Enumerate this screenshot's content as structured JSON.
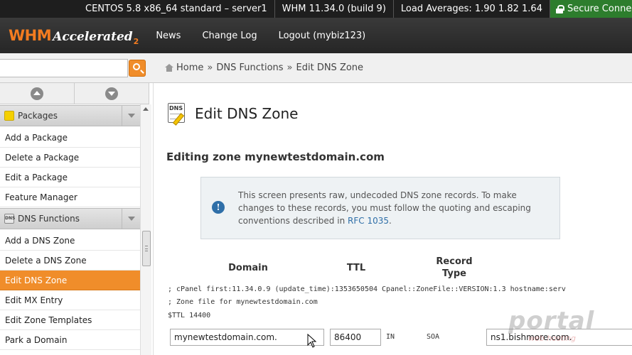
{
  "statusbar": {
    "server": "CENTOS 5.8 x86_64 standard – server1",
    "version": "WHM 11.34.0 (build 9)",
    "load": "Load Averages: 1.90 1.82 1.64",
    "secure": "Secure Connectio"
  },
  "header": {
    "logo_whm": "WHM",
    "logo_accelerated": "Accelerated",
    "logo_version": "2",
    "nav": [
      "News",
      "Change Log",
      "Logout (mybiz123)"
    ]
  },
  "search": {
    "value": "",
    "placeholder": ""
  },
  "breadcrumb": {
    "home": "Home",
    "section": "DNS Functions",
    "current": "Edit DNS Zone",
    "separator": "»"
  },
  "sidebar": {
    "packages_header": "Packages",
    "packages_items": [
      "Add a Package",
      "Delete a Package",
      "Edit a Package",
      "Feature Manager"
    ],
    "dns_header": "DNS Functions",
    "dns_items": [
      "Add a DNS Zone",
      "Delete a DNS Zone",
      "Edit DNS Zone",
      "Edit MX Entry",
      "Edit Zone Templates",
      "Park a Domain"
    ],
    "active_item": "Edit DNS Zone"
  },
  "main": {
    "title": "Edit DNS Zone",
    "subheading": "Editing zone mynewtestdomain.com",
    "info_text": "This screen presents raw, undecoded DNS zone records. To make changes to these records, you must follow the quoting and escaping conventions described in",
    "info_link": "RFC 1035",
    "info_tail": ".",
    "columns": {
      "domain": "Domain",
      "ttl": "TTL",
      "record_line1": "Record",
      "record_line2": "Type"
    },
    "zone_lines": [
      "; cPanel first:11.34.0.9 (update_time):1353650504 Cpanel::ZoneFile::VERSION:1.3 hostname:serv",
      "; Zone file for mynewtestdomain.com",
      "$TTL 14400"
    ],
    "record": {
      "domain": "mynewtestdomain.com.",
      "ttl": "86400",
      "class": "IN",
      "type": "SOA",
      "value": "ns1.bishmore.com."
    }
  },
  "watermark": {
    "big": "portal",
    "small": "web hosting"
  },
  "colors": {
    "accent": "#f08d2a",
    "header_bg": "#262626",
    "secure_bg": "#2d7d2d",
    "link": "#2f6fa8"
  }
}
